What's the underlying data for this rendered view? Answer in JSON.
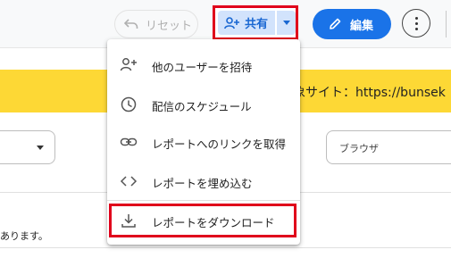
{
  "toolbar": {
    "reset_label": "リセット",
    "share_label": "共有",
    "edit_label": "編集"
  },
  "banner": {
    "text": "対象サイト：https://bunsek"
  },
  "filters": {
    "browser_label": "ブラウザ"
  },
  "body_note": "あります。",
  "share_menu": {
    "items": [
      {
        "label": "他のユーザーを招待",
        "icon": "person-add-icon"
      },
      {
        "label": "配信のスケジュール",
        "icon": "clock-icon"
      },
      {
        "label": "レポートへのリンクを取得",
        "icon": "link-icon"
      },
      {
        "label": "レポートを埋め込む",
        "icon": "code-icon"
      },
      {
        "label": "レポートをダウンロード",
        "icon": "download-icon"
      }
    ]
  },
  "colors": {
    "accent_blue": "#1a73e8",
    "share_bg": "#d2e3fc",
    "highlight_red": "#e0001b",
    "banner_yellow": "#fdd835"
  }
}
